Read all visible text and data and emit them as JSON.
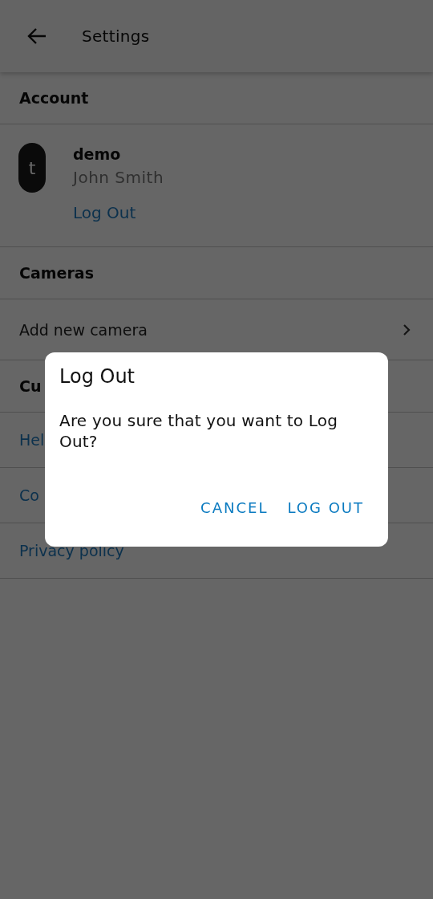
{
  "app_bar": {
    "title": "Settings"
  },
  "sections": [
    {
      "header": "Account",
      "kind": "account",
      "account": {
        "avatar_letter": "t",
        "username": "demo",
        "name": "John Smith",
        "action": "Log Out"
      }
    },
    {
      "header": "Cameras",
      "kind": "list",
      "items": [
        {
          "label": "Add new camera",
          "kind": "nav"
        }
      ]
    },
    {
      "header": "Cu",
      "kind": "list",
      "items": [
        {
          "label": "Hel",
          "kind": "link"
        },
        {
          "label": "Co",
          "kind": "link"
        },
        {
          "label": "Privacy policy",
          "kind": "link"
        }
      ]
    }
  ],
  "dialog": {
    "title": "Log Out",
    "message": "Are you sure that you want to Log Out?",
    "buttons": [
      "CANCEL",
      "LOG OUT"
    ]
  }
}
